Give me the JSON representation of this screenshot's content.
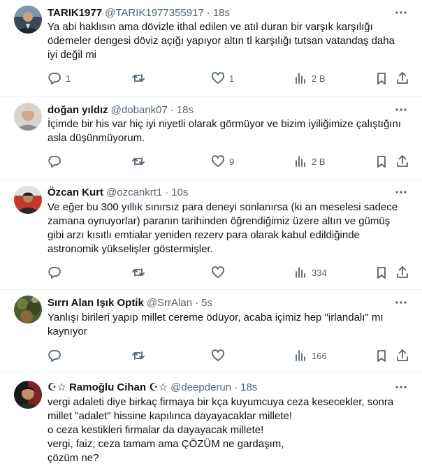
{
  "tweets": [
    {
      "name": "TARIK1977",
      "handle": "@TARIK1977355917",
      "time": "18s",
      "lines": [
        "Ya abi haklısın ama dövizle ithal edilen ve atıl duran bir varşık karşılığı",
        "ödemeler dengesi döviz açığı yapıyor altın tl karşılığı tutsan vatandaş daha",
        "iyi değil mi"
      ],
      "replies": "1",
      "retweets": "",
      "likes": "1",
      "views": "2 B"
    },
    {
      "name": "doğan yıldız",
      "handle": "@dobank07",
      "time": "18s",
      "lines": [
        "İçimde bir his var hiç iyi niyetli olarak görmüyor ve bizim iyiliğimize çalıştığını",
        "asla düşünmüyorum."
      ],
      "replies": "",
      "retweets": "",
      "likes": "9",
      "views": "2 B"
    },
    {
      "name": "Özcan Kurt",
      "handle": "@ozcankrt1",
      "time": "10s",
      "lines": [
        "Ve eğer bu 300 yıllık sınırsız para deneyi sonlanırsa (ki an meselesi sadece",
        "zamana oynuyorlar) paranın tarihinden öğrendiğimiz üzere altın ve gümüş",
        "gibi arzı kısıtlı emtialar yeniden rezerv para olarak kabul edildiğinde",
        "astronomik yükselişler göstermişler."
      ],
      "replies": "",
      "retweets": "",
      "likes": "",
      "views": "334"
    },
    {
      "name": "Sırrı Alan Işık Optik",
      "handle": "@SrrAlan",
      "time": "5s",
      "lines": [
        "Yanlışı birileri yapıp millet cereme ödüyor, acaba içimiz hep \"irlandalı\" mı",
        "kaynıyor"
      ],
      "replies": "",
      "retweets": "",
      "likes": "",
      "views": "166"
    },
    {
      "name": "☪︎☆ Ramoğlu Cihan ☪︎☆",
      "handle": "@deepderun",
      "time": "18s",
      "lines": [
        "vergi adaleti diye birkaç firmaya bir kça kuyumcuya ceza kesecekler, sonra",
        "millet \"adalet\" hissine kapılınca dayayacaklar millete!",
        "o ceza kestikleri firmalar da dayayacak millete!",
        "vergi, faiz, ceza tamam ama ÇÖZÜM ne gardaşım,",
        "çözüm ne?"
      ]
    }
  ],
  "colors": {
    "text": "#0f1419",
    "muted": "#536471",
    "divider": "#eff3f4"
  }
}
